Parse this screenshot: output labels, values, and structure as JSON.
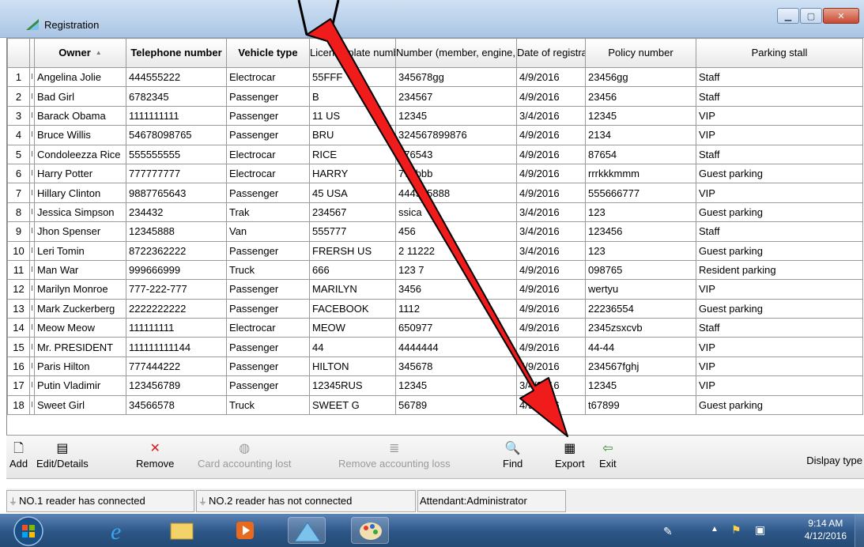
{
  "window": {
    "title": "Registration"
  },
  "grid": {
    "columns": [
      "Owner",
      "Telephone number",
      "Vehicle type",
      "License plate number",
      "Number (member, engine, etc.)",
      "Date of registration",
      "Policy number",
      "Parking stall"
    ],
    "rows": [
      {
        "n": "1",
        "mark": "I",
        "owner": "Angelina Jolie",
        "phone": "444555222",
        "vehicle": "Electrocar",
        "plate": "55FFF",
        "number": "345678gg",
        "date": "4/9/2016",
        "policy": "23456gg",
        "stall": "Staff"
      },
      {
        "n": "2",
        "mark": "I",
        "owner": "Bad Girl",
        "phone": "6782345",
        "vehicle": "Passenger",
        "plate": "B",
        "number": "234567",
        "date": "4/9/2016",
        "policy": "23456",
        "stall": "Staff"
      },
      {
        "n": "3",
        "mark": "I",
        "owner": "Barack Obama",
        "phone": "1111111111",
        "vehicle": "Passenger",
        "plate": "11 US",
        "number": "12345",
        "date": "3/4/2016",
        "policy": "12345",
        "stall": "VIP"
      },
      {
        "n": "4",
        "mark": "I",
        "owner": "Bruce Willis",
        "phone": "54678098765",
        "vehicle": "Passenger",
        "plate": "BRU",
        "number": "324567899876",
        "date": "4/9/2016",
        "policy": "2134",
        "stall": "VIP"
      },
      {
        "n": "5",
        "mark": "I",
        "owner": "Condoleezza Rice",
        "phone": "555555555",
        "vehicle": "Electrocar",
        "plate": "RICE",
        "number": "876543",
        "date": "4/9/2016",
        "policy": "87654",
        "stall": "Staff"
      },
      {
        "n": "6",
        "mark": "I",
        "owner": "Harry Potter",
        "phone": "777777777",
        "vehicle": "Electrocar",
        "plate": "HARRY",
        "number": "777bbb",
        "date": "4/9/2016",
        "policy": "rrrkkkmmm",
        "stall": "Guest parking"
      },
      {
        "n": "7",
        "mark": "I",
        "owner": "Hillary Clinton",
        "phone": "9887765643",
        "vehicle": "Passenger",
        "plate": "45 USA",
        "number": "444555888",
        "date": "4/9/2016",
        "policy": "555666777",
        "stall": "VIP"
      },
      {
        "n": "8",
        "mark": "I",
        "owner": "Jessica Simpson",
        "phone": "234432",
        "vehicle": "Trak",
        "plate": "234567",
        "number": "ssica",
        "date": "3/4/2016",
        "policy": "123",
        "stall": "Guest parking"
      },
      {
        "n": "9",
        "mark": "I",
        "owner": "Jhon Spenser",
        "phone": "12345888",
        "vehicle": "Van",
        "plate": "555777",
        "number": "456",
        "date": "3/4/2016",
        "policy": "123456",
        "stall": "Staff"
      },
      {
        "n": "10",
        "mark": "I",
        "owner": "Leri Tomin",
        "phone": "8722362222",
        "vehicle": "Passenger",
        "plate": "FRERSH US",
        "number": "2 11222",
        "date": "3/4/2016",
        "policy": "123",
        "stall": "Guest parking"
      },
      {
        "n": "11",
        "mark": "I",
        "owner": "Man War",
        "phone": "999666999",
        "vehicle": "Truck",
        "plate": "666",
        "number": "123 7",
        "date": "4/9/2016",
        "policy": "098765",
        "stall": "Resident parking"
      },
      {
        "n": "12",
        "mark": "I",
        "owner": "Marilyn Monroe",
        "phone": "777-222-777",
        "vehicle": "Passenger",
        "plate": "MARILYN",
        "number": "3456",
        "date": "4/9/2016",
        "policy": "wertyu",
        "stall": "VIP"
      },
      {
        "n": "13",
        "mark": "I",
        "owner": "Mark Zuckerberg",
        "phone": "2222222222",
        "vehicle": "Passenger",
        "plate": "FACEBOOK",
        "number": "1112",
        "date": "4/9/2016",
        "policy": "22236554",
        "stall": "Guest parking"
      },
      {
        "n": "14",
        "mark": "I",
        "owner": "Meow Meow",
        "phone": "111111111",
        "vehicle": "Electrocar",
        "plate": "MEOW",
        "number": "650977",
        "date": "4/9/2016",
        "policy": "2345zsxcvb",
        "stall": "Staff"
      },
      {
        "n": "15",
        "mark": "I",
        "owner": "Mr. PRESIDENT",
        "phone": "111111111144",
        "vehicle": "Passenger",
        "plate": "44",
        "number": "4444444",
        "date": "4/9/2016",
        "policy": "44-44",
        "stall": "VIP"
      },
      {
        "n": "16",
        "mark": "I",
        "owner": "Paris Hilton",
        "phone": "777444222",
        "vehicle": "Passenger",
        "plate": "HILTON",
        "number": "345678",
        "date": "4/9/2016",
        "policy": "234567fghj",
        "stall": "VIP"
      },
      {
        "n": "17",
        "mark": "I",
        "owner": "Putin Vladimir",
        "phone": "123456789",
        "vehicle": "Passenger",
        "plate": "12345RUS",
        "number": "12345",
        "date": "3/4/2016",
        "policy": "12345",
        "stall": "VIP"
      },
      {
        "n": "18",
        "mark": "I",
        "owner": "Sweet Girl",
        "phone": "34566578",
        "vehicle": "Truck",
        "plate": "SWEET G",
        "number": "56789",
        "date": "4/9/2016",
        "policy": "t67899",
        "stall": "Guest parking"
      }
    ]
  },
  "toolbar": {
    "add": "Add",
    "edit": "Edit/Details",
    "remove": "Remove",
    "card_lost": "Card accounting lost",
    "remove_loss": "Remove accounting loss",
    "find": "Find",
    "export": "Export",
    "exit": "Exit",
    "display_type": "Dislpay type"
  },
  "status": {
    "reader1": "NO.1 reader has connected",
    "reader2": "NO.2 reader has not connected",
    "attendant": "Attendant:Administrator"
  },
  "taskbar": {
    "time": "9:14 AM",
    "date": "4/12/2016"
  },
  "colors": {
    "arrow": "#f01b1b",
    "titlebar": "#b9d1ea",
    "taskbar": "#2c5686",
    "close_button": "#c84a30"
  },
  "icons": [
    "app-icon",
    "sort-ascending-icon",
    "add-icon",
    "edit-icon",
    "remove-icon",
    "card-icon",
    "remove-loss-icon",
    "find-icon",
    "export-icon",
    "exit-icon",
    "plug-icon",
    "start-orb-icon",
    "ie-icon",
    "explorer-icon",
    "media-player-icon",
    "registration-app-icon",
    "paint-icon",
    "handwriting-icon",
    "flag-icon",
    "network-icon"
  ]
}
